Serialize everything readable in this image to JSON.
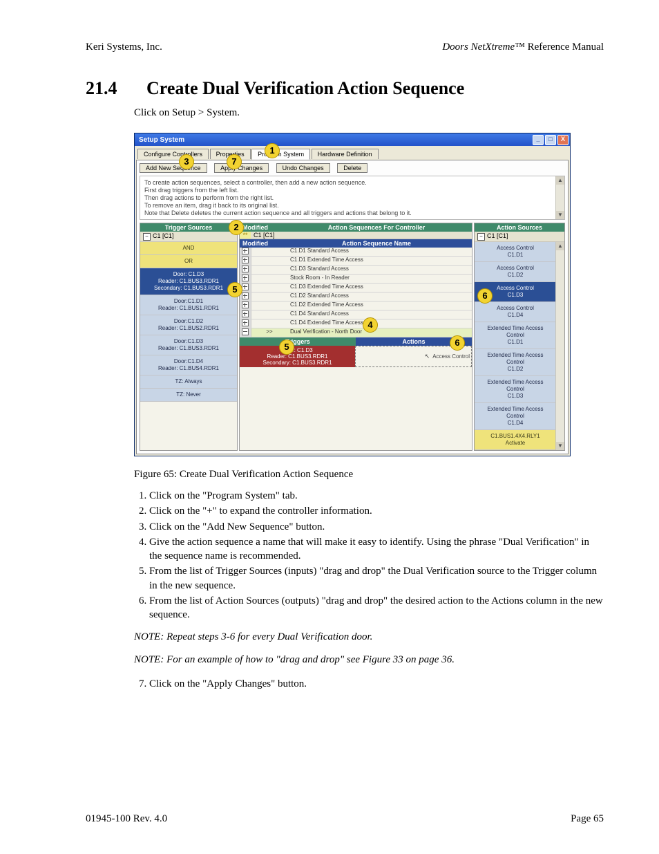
{
  "header": {
    "company": "Keri Systems, Inc.",
    "product": "Doors NetXtreme",
    "tm": "™",
    "suffix": " Reference Manual"
  },
  "section": {
    "number": "21.4",
    "title": "Create Dual Verification Action Sequence",
    "intro": "Click on Setup > System."
  },
  "figure": {
    "caption": "Figure 65: Create Dual Verification Action Sequence"
  },
  "win": {
    "title": "Setup System",
    "min": "_",
    "max": "□",
    "close": "X",
    "tabs": [
      "Configure Controllers",
      "Properties",
      "Program System",
      "Hardware Definition"
    ],
    "buttons": {
      "add": "Add New Sequence",
      "apply": "Apply Changes",
      "undo": "Undo Changes",
      "delete": "Delete"
    },
    "instructions": [
      "To create action sequences, select a controller, then add a new action sequence.",
      "First drag triggers from the left list.",
      "Then drag actions to perform from the right list.",
      "To remove an item, drag it back to its original list.",
      "Note that Delete deletes the current action sequence and all triggers and actions that belong to it."
    ],
    "trigger_sources": {
      "title": "Trigger Sources",
      "root": "C1  [C1]",
      "items": [
        {
          "cls": "yellow",
          "lines": [
            "AND"
          ]
        },
        {
          "cls": "yellow",
          "lines": [
            "OR"
          ]
        },
        {
          "cls": "selblue",
          "lines": [
            "Door: C1.D3",
            "Reader: C1.BUS3.RDR1",
            "Secondary: C1.BUS3.RDR1"
          ]
        },
        {
          "cls": "ltblue",
          "lines": [
            "Door:C1.D1",
            "Reader: C1.BUS1.RDR1"
          ]
        },
        {
          "cls": "ltblue",
          "lines": [
            "Door:C1.D2",
            "Reader: C1.BUS2.RDR1"
          ]
        },
        {
          "cls": "ltblue",
          "lines": [
            "Door:C1.D3",
            "Reader: C1.BUS3.RDR1"
          ]
        },
        {
          "cls": "ltblue",
          "lines": [
            "Door:C1.D4",
            "Reader: C1.BUS4.RDR1"
          ]
        },
        {
          "cls": "ltblue",
          "lines": [
            "TZ: Always"
          ]
        },
        {
          "cls": "ltblue",
          "lines": [
            "TZ: Never"
          ]
        }
      ]
    },
    "mid": {
      "modified": "Modified",
      "asfc": "Action Sequences For Controller",
      "star": "**",
      "c1": "C1  [C1]",
      "seqname_hdr": "Action Sequence Name",
      "sequences": [
        {
          "icon": "plus",
          "mod": "",
          "name": "C1.D1 Standard Access",
          "sel": false
        },
        {
          "icon": "plus",
          "mod": "",
          "name": "C1.D1 Extended Time Access",
          "sel": false
        },
        {
          "icon": "plus",
          "mod": "",
          "name": "C1.D3 Standard Access",
          "sel": false
        },
        {
          "icon": "plus",
          "mod": "",
          "name": "Stock Room - In Reader",
          "sel": false
        },
        {
          "icon": "plus",
          "mod": "",
          "name": "C1.D3 Extended Time Access",
          "sel": false
        },
        {
          "icon": "plus",
          "mod": "",
          "name": "C1.D2 Standard Access",
          "sel": false
        },
        {
          "icon": "plus",
          "mod": "",
          "name": "C1.D2 Extended Time Access",
          "sel": false
        },
        {
          "icon": "plus",
          "mod": "",
          "name": "C1.D4 Standard Access",
          "sel": false
        },
        {
          "icon": "plus",
          "mod": "",
          "name": "C1.D4 Extended Time Access",
          "sel": false
        },
        {
          "icon": "minus",
          "mod": ">>",
          "name": "Dual Verification - North Door",
          "sel": true
        }
      ],
      "triggers_hdr": "Triggers",
      "actions_hdr": "Actions",
      "trigger_drop": [
        "Door: C1.D3",
        "Reader: C1.BUS3.RDR1",
        "Secondary: C1.BUS3.RDR1"
      ],
      "action_drop": "Access Control"
    },
    "action_sources": {
      "title": "Action Sources",
      "root": "C1  [C1]",
      "items": [
        {
          "cls": "ltblue",
          "lines": [
            "Access Control",
            "C1.D1"
          ]
        },
        {
          "cls": "ltblue",
          "lines": [
            "Access Control",
            "C1.D2"
          ]
        },
        {
          "cls": "selblue",
          "lines": [
            "Access Control",
            "C1.D3"
          ]
        },
        {
          "cls": "ltblue",
          "lines": [
            "Access Control",
            "C1.D4"
          ]
        },
        {
          "cls": "ltblue",
          "lines": [
            "Extended Time Access",
            "Control",
            "C1.D1"
          ]
        },
        {
          "cls": "ltblue",
          "lines": [
            "Extended Time Access",
            "Control",
            "C1.D2"
          ]
        },
        {
          "cls": "ltblue",
          "lines": [
            "Extended Time Access",
            "Control",
            "C1.D3"
          ]
        },
        {
          "cls": "ltblue",
          "lines": [
            "Extended Time Access",
            "Control",
            "C1.D4"
          ]
        },
        {
          "cls": "yellow",
          "lines": [
            "C1.BUS1.4X4.RLY1",
            "Activate"
          ]
        }
      ]
    }
  },
  "callouts": [
    "1",
    "2",
    "3",
    "4",
    "5",
    "5",
    "6",
    "6",
    "7"
  ],
  "steps_a": [
    "Click on the \"Program System\" tab.",
    "Click on the \"+\" to expand the controller information.",
    "Click on the \"Add New Sequence\" button.",
    "Give the action sequence a name that will make it easy to identify. Using the phrase \"Dual Verification\" in the sequence name is recommended.",
    "From the list of Trigger Sources (inputs) \"drag and drop\" the Dual Verification source to the Trigger column in the new sequence.",
    "From the list of Action Sources (outputs) \"drag and drop\" the desired action to the Actions column in the new sequence."
  ],
  "notes": {
    "a": "NOTE: Repeat steps 3-6 for every Dual Verification door.",
    "b": "NOTE: For an example of how to \"drag and drop\" see Figure 33 on page 36."
  },
  "steps_b": [
    "Click on the \"Apply Changes\" button."
  ],
  "footer": {
    "left": "01945-100  Rev. 4.0",
    "right": "Page 65"
  }
}
